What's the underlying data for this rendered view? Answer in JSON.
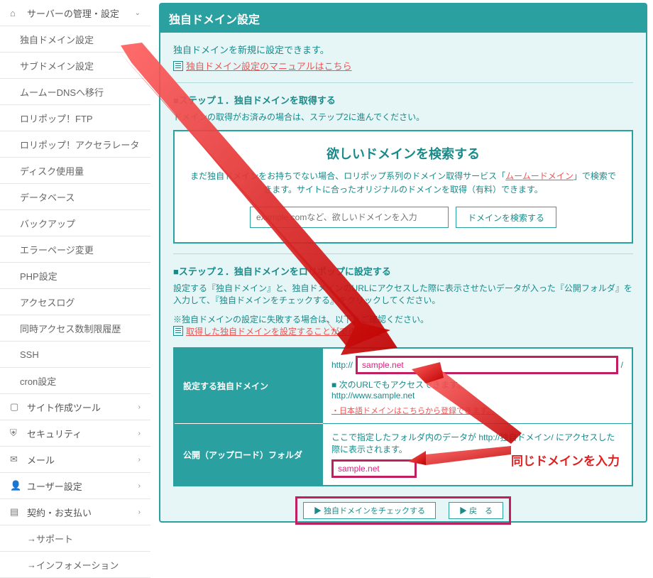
{
  "sidebar": {
    "header": {
      "label": "サーバーの管理・設定",
      "chevron": "⌄"
    },
    "items": [
      {
        "label": "独自ドメイン設定",
        "active": true
      },
      {
        "label": "サブドメイン設定"
      },
      {
        "label": "ムームーDNSへ移行"
      },
      {
        "label": "ロリポップ！FTP"
      },
      {
        "label": "ロリポップ！アクセラレータ"
      },
      {
        "label": "ディスク使用量"
      },
      {
        "label": "データベース"
      },
      {
        "label": "バックアップ"
      },
      {
        "label": "エラーページ変更"
      },
      {
        "label": "PHP設定"
      },
      {
        "label": "アクセスログ"
      },
      {
        "label": "同時アクセス数制限履歴"
      },
      {
        "label": "SSH"
      },
      {
        "label": "cron設定"
      }
    ],
    "groups": [
      {
        "icon": "display-icon",
        "label": "サイト作成ツール"
      },
      {
        "icon": "shield-icon",
        "label": "セキュリティ"
      },
      {
        "icon": "mail-icon",
        "label": "メール"
      },
      {
        "icon": "user-icon",
        "label": "ユーザー設定"
      },
      {
        "icon": "card-icon",
        "label": "契約・お支払い"
      }
    ],
    "footer": [
      {
        "label": "サポート"
      },
      {
        "label": "インフォメーション"
      }
    ]
  },
  "panel": {
    "title": "独自ドメイン設定",
    "intro": "独自ドメインを新規に設定できます。",
    "manual_link": "独自ドメイン設定のマニュアルはこちら"
  },
  "step1": {
    "title": "■ステップ１．独自ドメインを取得する",
    "desc": "ドメインの取得がお済みの場合は、ステップ2に進んでください。",
    "box_title": "欲しいドメインを検索する",
    "box_text1": "まだ独自ドメインをお持ちでない場合、ロリポップ系列のドメイン取得サービス「",
    "box_link": "ムームードメイン",
    "box_text2": "」で検索できます。サイトに合ったオリジナルのドメインを取得（有料）できます。",
    "search_placeholder": "example.comなど、欲しいドメインを入力",
    "search_button": "ドメインを検索する"
  },
  "step2": {
    "title": "■ステップ２．独自ドメインをロリポップに設定する",
    "desc": "設定する『独自ドメイン』と、独自ドメインのURLにアクセスした際に表示させたいデータが入った『公開フォルダ』を入力して、『独自ドメインをチェックする』をクリックしてください。",
    "note": "※独自ドメインの設定に失敗する場合は、以下をご確認ください。",
    "err_link": "取得した独自ドメインを設定することができません",
    "row1_label": "設定する独自ドメイン",
    "http_prefix": "http://",
    "domain_value": "sample.net",
    "slash": "/",
    "also_label": "■ 次のURLでもアクセスできます。",
    "also_url": "http://www.sample.net",
    "jp_link": "・日本語ドメインはこちらから登録できます。",
    "row2_label": "公開（アップロード）フォルダ",
    "row2_desc": "ここで指定したフォルダ内のデータが http://独自ドメイン/ にアクセスした際に表示されます。",
    "folder_value": "sample.net",
    "check_button": "▶ 独自ドメインをチェックする",
    "back_button": "▶ 戻　る"
  },
  "annotation": {
    "callout": "同じドメインを入力"
  }
}
